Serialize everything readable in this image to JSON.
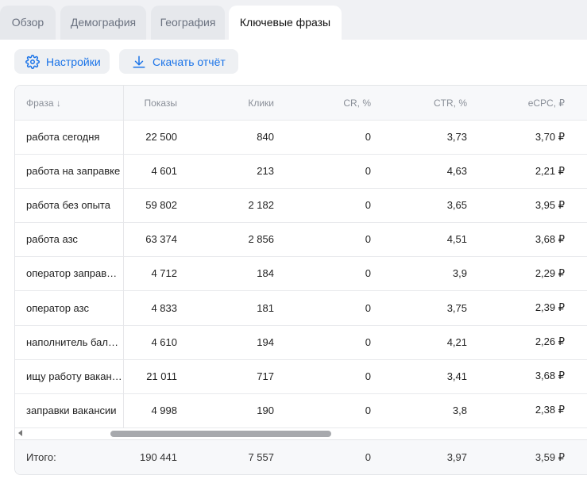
{
  "tabs": [
    {
      "label": "Обзор"
    },
    {
      "label": "Демография"
    },
    {
      "label": "География"
    },
    {
      "label": "Ключевые фразы"
    }
  ],
  "toolbar": {
    "settings_label": "Настройки",
    "download_label": "Скачать отчёт",
    "settings_icon": "gear-icon",
    "download_icon": "download-icon",
    "accent_color": "#1a73e8"
  },
  "table": {
    "columns": {
      "phrase": "Фраза ↓",
      "impressions": "Показы",
      "clicks": "Клики",
      "cr": "CR, %",
      "ctr": "CTR, %",
      "ecpc": "eCPC, ₽"
    },
    "rows": [
      {
        "phrase": "работа сегодня",
        "impressions": "22 500",
        "clicks": "840",
        "cr": "0",
        "ctr": "3,73",
        "ecpc": "3,70 ₽"
      },
      {
        "phrase": "работа на заправке",
        "impressions": "4 601",
        "clicks": "213",
        "cr": "0",
        "ctr": "4,63",
        "ecpc": "2,21 ₽"
      },
      {
        "phrase": "работа без опыта",
        "impressions": "59 802",
        "clicks": "2 182",
        "cr": "0",
        "ctr": "3,65",
        "ecpc": "3,95 ₽"
      },
      {
        "phrase": "работа азс",
        "impressions": "63 374",
        "clicks": "2 856",
        "cr": "0",
        "ctr": "4,51",
        "ecpc": "3,68 ₽"
      },
      {
        "phrase": "оператор заправ…",
        "impressions": "4 712",
        "clicks": "184",
        "cr": "0",
        "ctr": "3,9",
        "ecpc": "2,29 ₽"
      },
      {
        "phrase": "оператор азс",
        "impressions": "4 833",
        "clicks": "181",
        "cr": "0",
        "ctr": "3,75",
        "ecpc": "2,39 ₽"
      },
      {
        "phrase": "наполнитель балл…",
        "impressions": "4 610",
        "clicks": "194",
        "cr": "0",
        "ctr": "4,21",
        "ecpc": "2,26 ₽"
      },
      {
        "phrase": "ищу работу вакан…",
        "impressions": "21 011",
        "clicks": "717",
        "cr": "0",
        "ctr": "3,41",
        "ecpc": "3,68 ₽"
      },
      {
        "phrase": "заправки вакансии",
        "impressions": "4 998",
        "clicks": "190",
        "cr": "0",
        "ctr": "3,8",
        "ecpc": "2,38 ₽"
      }
    ],
    "total": {
      "label": "Итого:",
      "impressions": "190 441",
      "clicks": "7 557",
      "cr": "0",
      "ctr": "3,97",
      "ecpc": "3,59 ₽"
    }
  }
}
